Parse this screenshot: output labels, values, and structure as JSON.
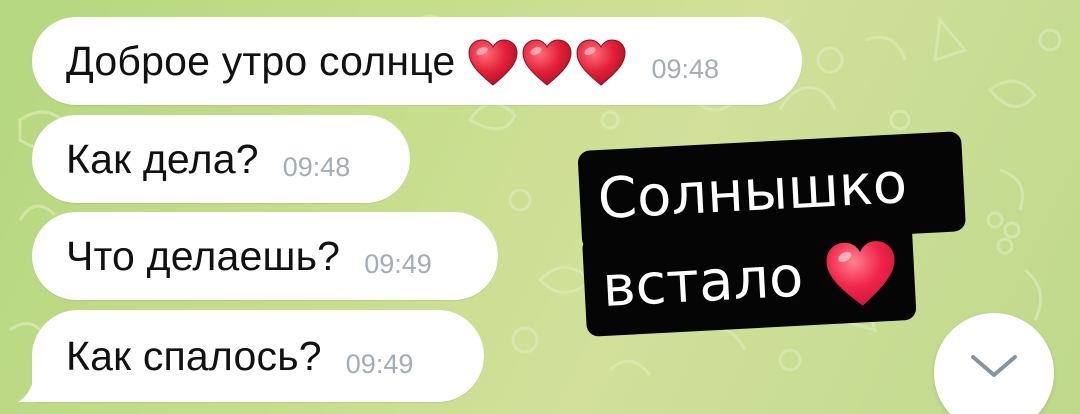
{
  "messages": [
    {
      "text": "Доброе утро солнце",
      "time": "09:48",
      "emoji": [
        "red-heart",
        "red-heart",
        "red-heart"
      ]
    },
    {
      "text": "Как дела?",
      "time": "09:48"
    },
    {
      "text": "Что делаешь?",
      "time": "09:49"
    },
    {
      "text": "Как спалось?",
      "time": "09:49"
    }
  ],
  "sticker": {
    "line1": "Солнышко",
    "line2": "встало",
    "emoji": "red-heart"
  },
  "scroll_button": {
    "icon": "chevron-down-icon"
  },
  "colors": {
    "wallpaper": "#c6de8c",
    "bubble": "#ffffff",
    "timestamp": "#a4adb4",
    "heart": "#e3203a"
  }
}
